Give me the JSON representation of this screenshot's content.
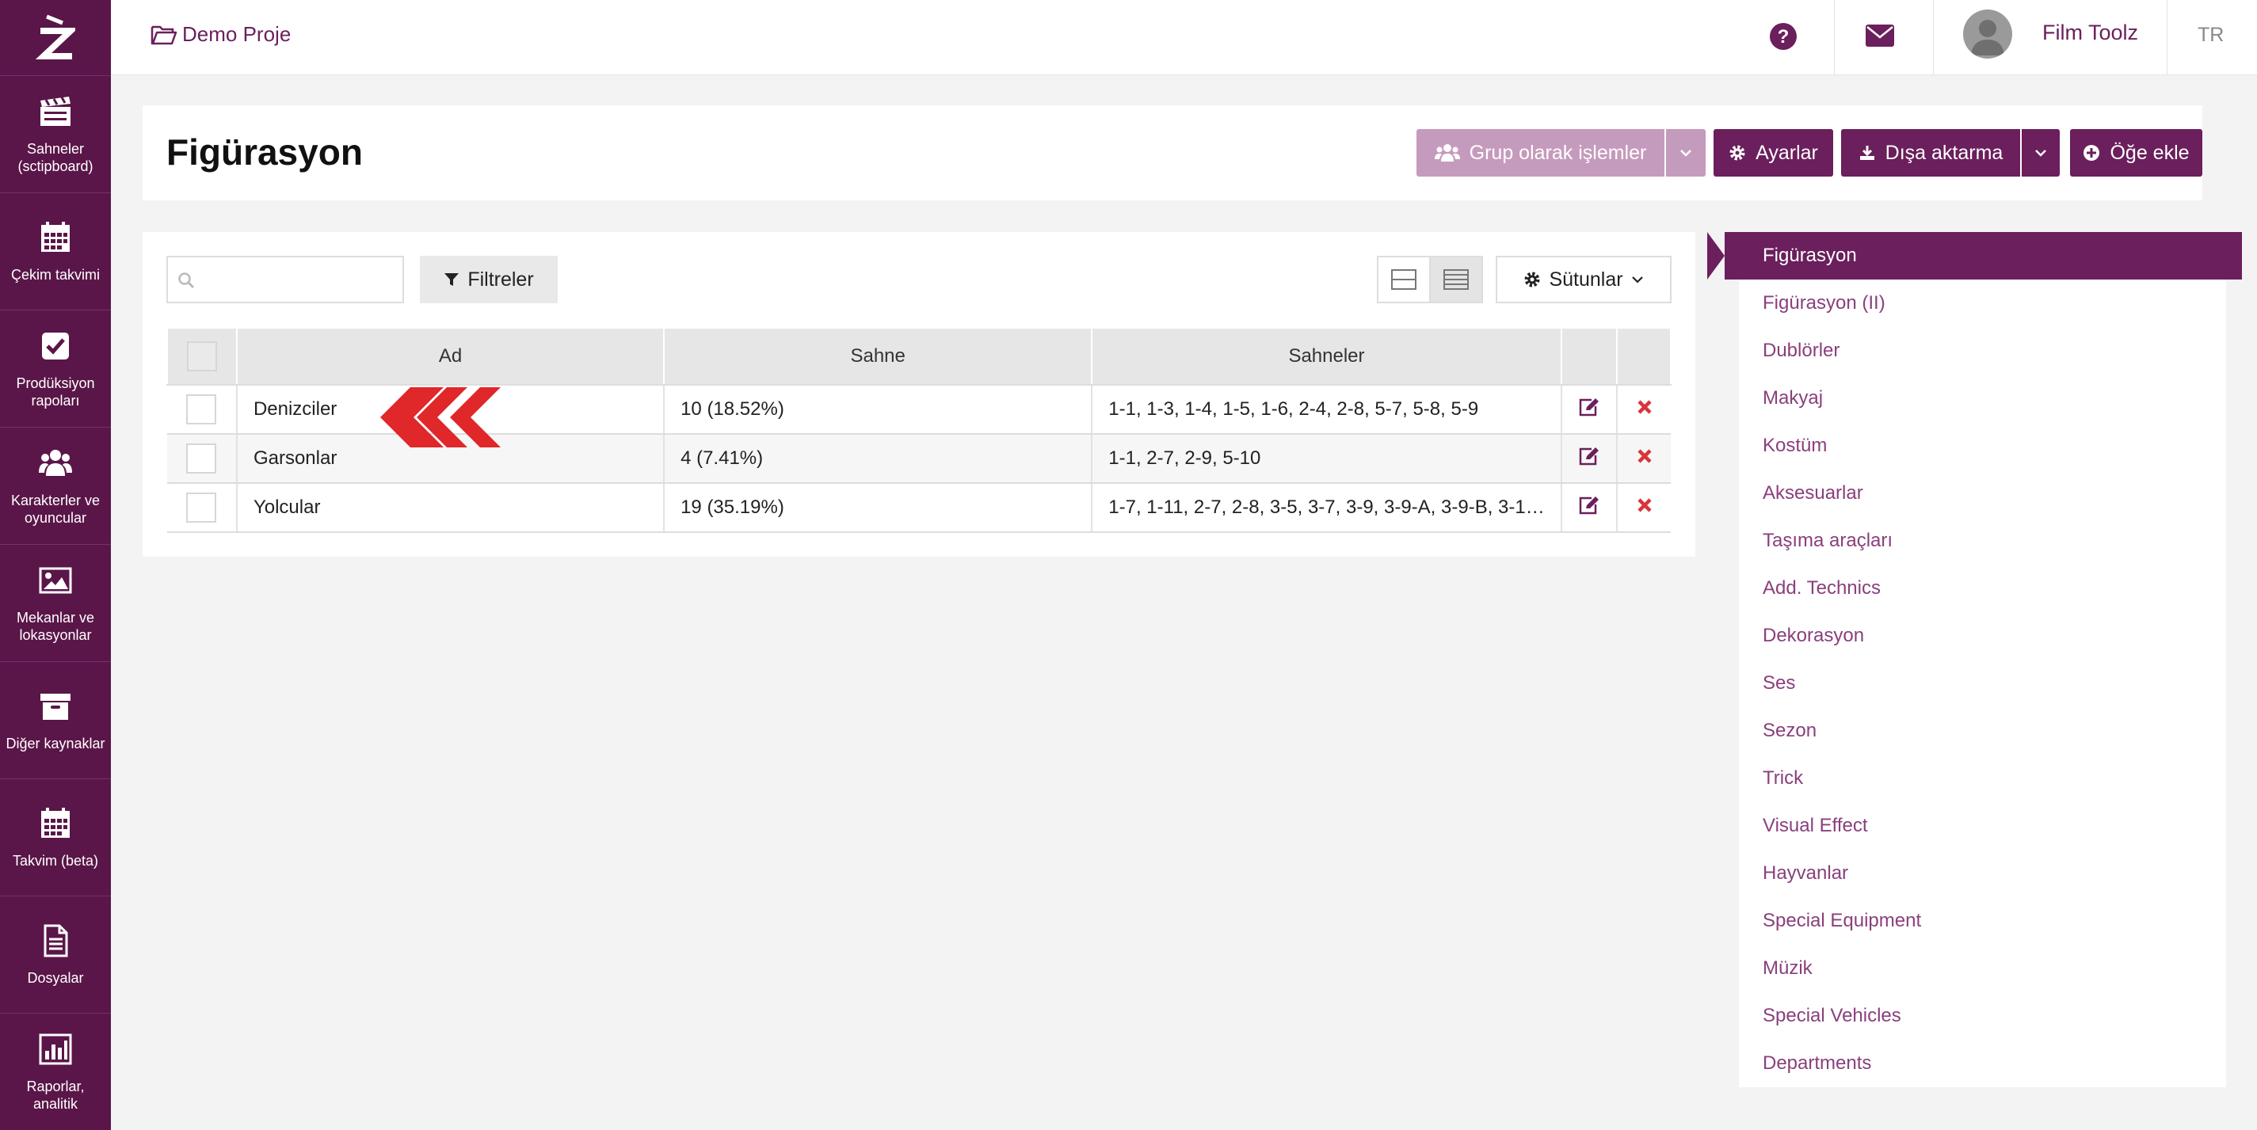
{
  "app": {
    "project": "Demo Proje",
    "user_name": "Film Toolz",
    "language": "TR"
  },
  "sidebar": {
    "items": [
      {
        "label": "Sahneler (sctipboard)",
        "icon": "clapperboard-icon"
      },
      {
        "label": "Çekim takvimi",
        "icon": "calendar-icon"
      },
      {
        "label": "Prodüksiyon rapoları",
        "icon": "checkbox-icon"
      },
      {
        "label": "Karakterler ve oyuncular",
        "icon": "users-icon"
      },
      {
        "label": "Mekanlar ve lokasyonlar",
        "icon": "image-icon"
      },
      {
        "label": "Diğer kaynaklar",
        "icon": "archive-icon"
      },
      {
        "label": "Takvim (beta)",
        "icon": "calendar-icon"
      },
      {
        "label": "Dosyalar",
        "icon": "file-icon"
      },
      {
        "label": "Raporlar, analitik",
        "icon": "bar-chart-icon"
      }
    ]
  },
  "header": {
    "title": "Figürasyon",
    "group_ops": "Grup olarak işlemler",
    "settings": "Ayarlar",
    "export": "Dışa aktarma",
    "add_item": "Öğe ekle"
  },
  "toolbar": {
    "search_placeholder": "",
    "filters": "Filtreler",
    "columns": "Sütunlar"
  },
  "table": {
    "headers": [
      "Ad",
      "Sahne",
      "Sahneler"
    ],
    "rows": [
      {
        "name": "Denizciler",
        "scene": "10 (18.52%)",
        "scenes": "1-1, 1-3, 1-4, 1-5, 1-6, 2-4, 2-8, 5-7, 5-8, 5-9"
      },
      {
        "name": "Garsonlar",
        "scene": "4 (7.41%)",
        "scenes": "1-1, 2-7, 2-9, 5-10"
      },
      {
        "name": "Yolcular",
        "scene": "19 (35.19%)",
        "scenes": "1-7, 1-11, 2-7, 2-8, 3-5, 3-7, 3-9, 3-9-A, 3-9-B, 3-1…"
      }
    ]
  },
  "categories": {
    "active": "Figürasyon",
    "items": [
      "Figürasyon (II)",
      "Dublörler",
      "Makyaj",
      "Kostüm",
      "Aksesuarlar",
      "Taşıma araçları",
      "Add. Technics",
      "Dekorasyon",
      "Ses",
      "Sezon",
      "Trick",
      "Visual Effect",
      "Hayvanlar",
      "Special Equipment",
      "Müzik",
      "Special Vehicles",
      "Departments"
    ]
  },
  "colors": {
    "brand": "#6b1f5c",
    "sidebar": "#5a1648",
    "delete": "#d9343c",
    "annotation_arrow": "#e0272a"
  }
}
